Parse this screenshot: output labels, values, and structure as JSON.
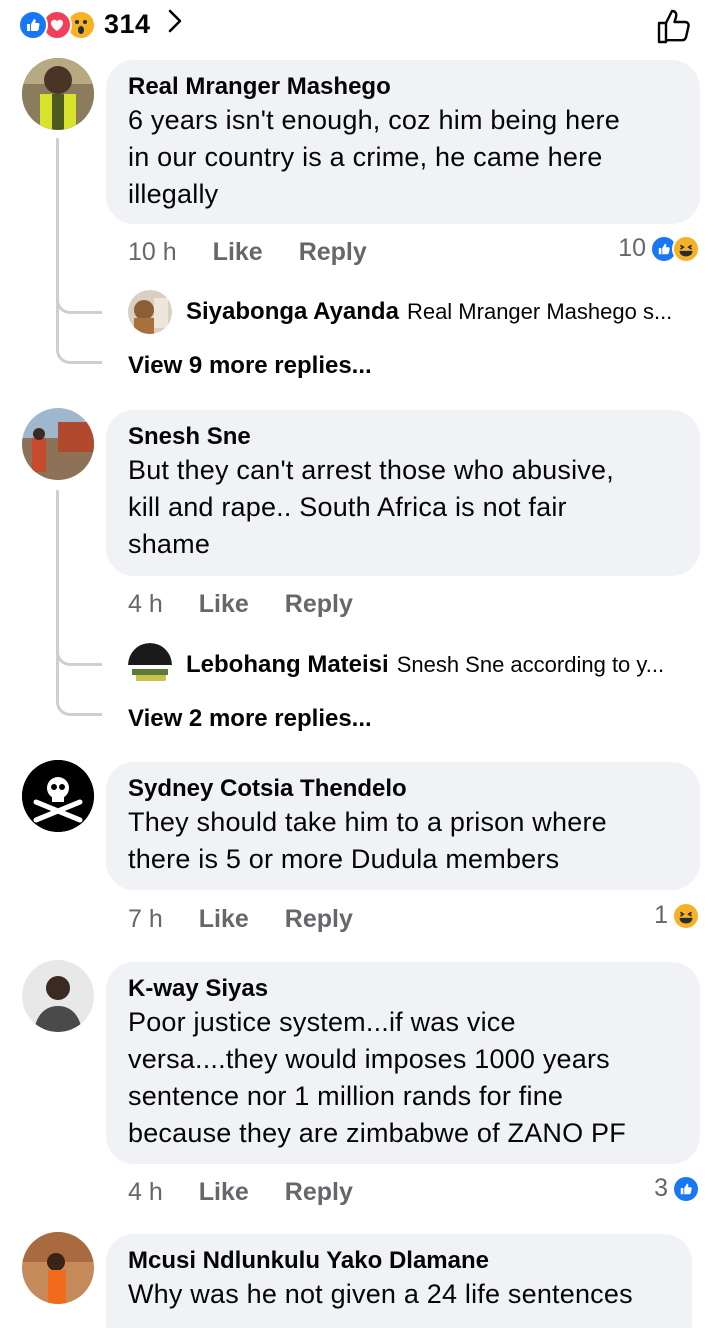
{
  "top": {
    "reaction_total": "314",
    "reaction_icons": [
      "like-icon",
      "love-icon",
      "wow-icon"
    ]
  },
  "comments": [
    {
      "author": "Real Mranger Mashego",
      "text_lines": [
        "6 years isn't enough, coz him being here",
        "in our country is a crime, he came here",
        "illegally"
      ],
      "time": "10 h",
      "like": "Like",
      "reply": "Reply",
      "reaction_count": "10",
      "reply_preview": {
        "author": "Siyabonga Ayanda",
        "text": "Real Mranger Mashego s..."
      },
      "view_more": "View 9 more replies..."
    },
    {
      "author": "Snesh Sne",
      "text_lines": [
        "But they can't arrest those who abusive,",
        "kill and rape.. South Africa is not fair",
        "shame"
      ],
      "time": "4 h",
      "like": "Like",
      "reply": "Reply",
      "reply_preview": {
        "author": "Lebohang Mateisi",
        "text": "Snesh Sne according to y..."
      },
      "view_more": "View 2 more replies..."
    },
    {
      "author": "Sydney Cotsia Thendelo",
      "text_lines": [
        "They should take him to a prison where",
        "there is 5 or more Dudula members"
      ],
      "time": "7 h",
      "like": "Like",
      "reply": "Reply",
      "reaction_count": "1"
    },
    {
      "author": "K-way Siyas",
      "text_lines": [
        "Poor justice system...if was vice",
        "versa....they would imposes 1000 years",
        "sentence nor 1 million rands for fine",
        "because they are zimbabwe of ZANO PF"
      ],
      "time": "4 h",
      "like": "Like",
      "reply": "Reply",
      "reaction_count": "3"
    },
    {
      "author": "Mcusi Ndlunkulu Yako Dlamane",
      "text_lines": [
        "Why was he not given a 24 life sentences"
      ]
    }
  ],
  "colors": {
    "like_blue": "#1877f2",
    "love_red": "#f33e58",
    "haha_yellow": "#f7b125",
    "bubble": "#f0f2f5",
    "meta_gray": "#65676b"
  }
}
